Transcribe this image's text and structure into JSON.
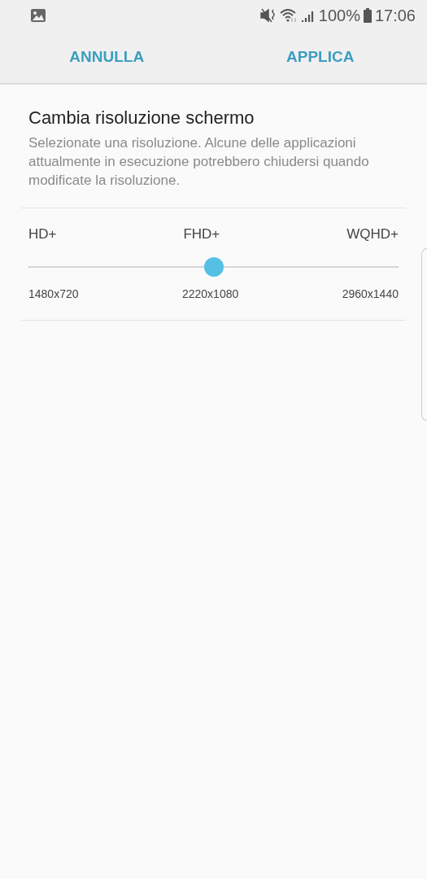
{
  "status_bar": {
    "battery": "100%",
    "time": "17:06"
  },
  "action_bar": {
    "buttons": [
      "ANNULLA",
      "APPLICA"
    ]
  },
  "title": "Cambia risoluzione schermo",
  "description": "Selezionate una risoluzione. Alcune delle applicazioni attualmente in esecuzione potrebbero chiudersi quando modificate la risoluzione.",
  "resolution_slider": {
    "level": 0.5,
    "options": [
      {
        "name": "HD+",
        "resolution": "1480x720"
      },
      {
        "name": "FHD+",
        "resolution": "2220x1080"
      },
      {
        "name": "WQHD+",
        "resolution": "2960x1440"
      }
    ]
  }
}
